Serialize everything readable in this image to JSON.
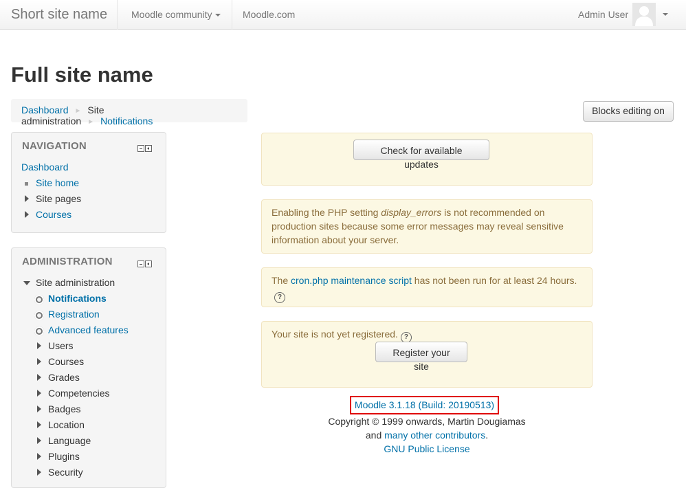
{
  "navbar": {
    "brand": "Short site name",
    "community_menu": "Moodle community",
    "moodle_com": "Moodle.com",
    "user_name": "Admin User"
  },
  "page": {
    "title": "Full site name",
    "blocks_editing_button": "Blocks editing on"
  },
  "breadcrumb": [
    "Dashboard",
    "Site administration",
    "Notifications"
  ],
  "navigation_block": {
    "title": "NAVIGATION",
    "items": [
      "Dashboard",
      "Site home",
      "Site pages",
      "Courses"
    ]
  },
  "admin_block": {
    "title": "ADMINISTRATION",
    "root": "Site administration",
    "items": [
      "Notifications",
      "Registration",
      "Advanced features",
      "Users",
      "Courses",
      "Grades",
      "Competencies",
      "Badges",
      "Location",
      "Language",
      "Plugins",
      "Security"
    ]
  },
  "notices": {
    "check_updates_button": "Check for available updates",
    "display_errors_pre": "Enabling the PHP setting ",
    "display_errors_em": "display_errors",
    "display_errors_post": " is not recommended on production sites because some error messages may reveal sensitive information about your server.",
    "cron_pre": "The ",
    "cron_link": "cron.php maintenance script",
    "cron_post": " has not been run for at least 24 hours.",
    "registration_text": "Your site is not yet registered.",
    "register_button": "Register your site"
  },
  "footer": {
    "version": "Moodle 3.1.18 (Build: 20190513)",
    "copyright": "Copyright © 1999 onwards, Martin Dougiamas",
    "and_text": "and ",
    "contributors_link": "many other contributors",
    "period": ".",
    "license_link": "GNU Public License"
  },
  "colors": {
    "link": "#0070a8",
    "notice_bg": "#fcf8e3",
    "notice_text": "#8a6d3b",
    "highlight_border": "#e00000"
  }
}
